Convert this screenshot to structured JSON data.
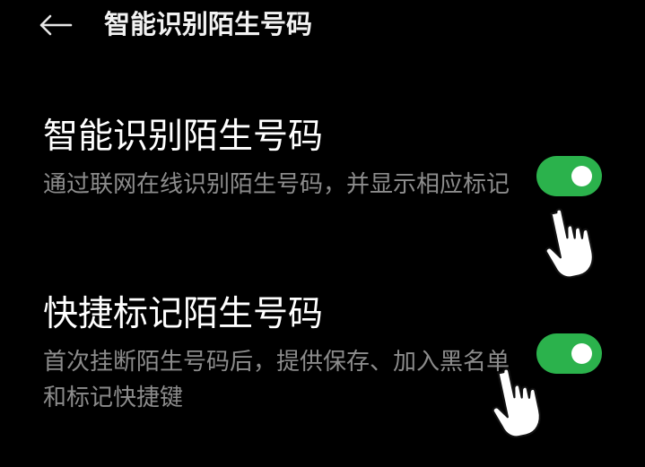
{
  "header": {
    "back_icon": "arrow-left-icon",
    "title": "智能识别陌生号码"
  },
  "settings": [
    {
      "title": "智能识别陌生号码",
      "description": "通过联网在线识别陌生号码，并显示相应标记",
      "enabled": true
    },
    {
      "title": "快捷标记陌生号码",
      "description": "首次挂断陌生号码后，提供保存、加入黑名单和标记快捷键",
      "enabled": true
    }
  ],
  "colors": {
    "background": "#000000",
    "toggle_on": "#2bb24c",
    "description_text": "#8c8c8c"
  },
  "overlay_icons": [
    "hand-pointer-icon",
    "hand-pointer-icon"
  ]
}
